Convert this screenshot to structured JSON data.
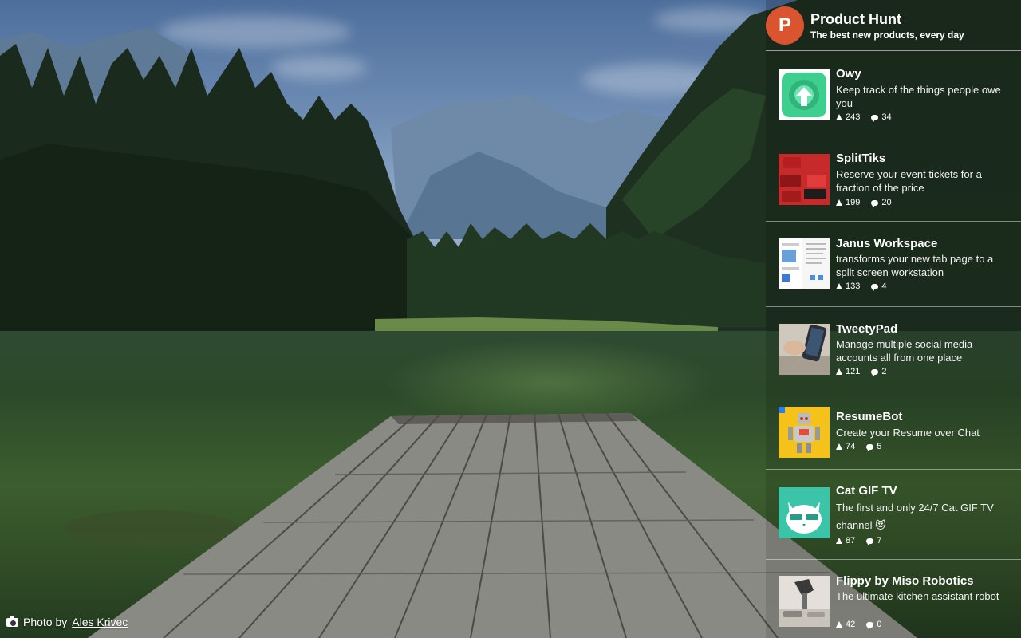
{
  "header": {
    "logo_letter": "P",
    "title": "Product Hunt",
    "tagline": "The best new products, every day"
  },
  "products": [
    {
      "name": "Owy",
      "tagline": "Keep track of the things people owe you",
      "upvotes": "243",
      "comments": "34",
      "thumb": "owy-logo"
    },
    {
      "name": "SplitTiks",
      "tagline": "Reserve your event tickets for a fraction of the price",
      "upvotes": "199",
      "comments": "20",
      "thumb": "splittiks-logo"
    },
    {
      "name": "Janus Workspace",
      "tagline": "transforms your new tab page to a split screen workstation",
      "upvotes": "133",
      "comments": "4",
      "thumb": "janus-screenshot"
    },
    {
      "name": "TweetyPad",
      "tagline": "Manage multiple social media accounts all from one place",
      "upvotes": "121",
      "comments": "2",
      "thumb": "tweetypad-photo"
    },
    {
      "name": "ResumeBot",
      "tagline": "Create your Resume over Chat",
      "upvotes": "74",
      "comments": "5",
      "thumb": "resumebot-robot"
    },
    {
      "name": "Cat GIF TV",
      "tagline": "The first and only 24/7 Cat GIF TV channel 😻",
      "upvotes": "87",
      "comments": "7",
      "thumb": "cat-gif-tv-logo"
    },
    {
      "name": "Flippy by Miso Robotics",
      "tagline": "The ultimate kitchen assistant robot",
      "upvotes": "42",
      "comments": "0",
      "thumb": "flippy-photo"
    }
  ],
  "credit": {
    "prefix": "Photo by",
    "author": "Ales Krivec"
  },
  "colors": {
    "ph_brand": "#da552f",
    "owy_green": "#3ecf8e",
    "splittiks_red": "#c62a2a",
    "resumebot_yellow": "#f5c21b",
    "cat_teal": "#3cc4a8"
  }
}
